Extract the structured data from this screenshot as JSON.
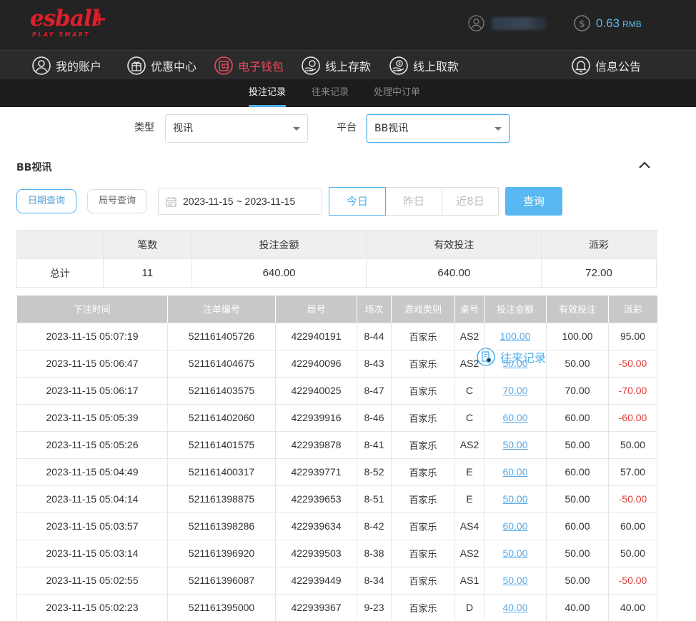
{
  "brand": {
    "logo_main": "esball",
    "logo_plus": "+",
    "logo_sub": "PLAY SMART",
    "color": "#e21e2a"
  },
  "account": {
    "balance": "0.63",
    "currency": "RMB"
  },
  "nav": [
    {
      "label": "我的账户",
      "icon": "user-icon"
    },
    {
      "label": "优惠中心",
      "icon": "gift-icon"
    },
    {
      "label": "电子钱包",
      "icon": "wallet-icon"
    },
    {
      "label": "线上存款",
      "icon": "deposit-icon"
    },
    {
      "label": "线上取款",
      "icon": "withdraw-icon"
    },
    {
      "label": "往来记录",
      "icon": "records-icon"
    },
    {
      "label": "信息公告",
      "icon": "bell-icon"
    }
  ],
  "subnav": [
    {
      "label": "投注记录",
      "active": true
    },
    {
      "label": "往来记录",
      "active": false
    },
    {
      "label": "处理中订单",
      "active": false
    }
  ],
  "filters": {
    "type_label": "类型",
    "type_value": "视讯",
    "platform_label": "平台",
    "platform_value": "BB视讯"
  },
  "section_title": "BB视讯",
  "query": {
    "date_query": "日期查询",
    "round_query": "局号查询",
    "date_range": "2023-11-15 ~ 2023-11-15",
    "today": "今日",
    "yesterday": "昨日",
    "last8": "近8日",
    "submit": "查询"
  },
  "summary": {
    "headers": [
      "",
      "笔数",
      "投注金额",
      "有效投注",
      "派彩"
    ],
    "row": [
      "总计",
      "11",
      "640.00",
      "640.00",
      "72.00"
    ]
  },
  "table": {
    "headers": [
      "下注时间",
      "注单编号",
      "局号",
      "场次",
      "游戏类别",
      "桌号",
      "投注金额",
      "有效投注",
      "派彩"
    ],
    "rows": [
      [
        "2023-11-15 05:07:19",
        "521161405726",
        "422940191",
        "8-44",
        "百家乐",
        "AS2",
        "100.00",
        "100.00",
        "95.00"
      ],
      [
        "2023-11-15 05:06:47",
        "521161404675",
        "422940096",
        "8-43",
        "百家乐",
        "AS2",
        "50.00",
        "50.00",
        "-50.00"
      ],
      [
        "2023-11-15 05:06:17",
        "521161403575",
        "422940025",
        "8-47",
        "百家乐",
        "C",
        "70.00",
        "70.00",
        "-70.00"
      ],
      [
        "2023-11-15 05:05:39",
        "521161402060",
        "422939916",
        "8-46",
        "百家乐",
        "C",
        "60.00",
        "60.00",
        "-60.00"
      ],
      [
        "2023-11-15 05:05:26",
        "521161401575",
        "422939878",
        "8-41",
        "百家乐",
        "AS2",
        "50.00",
        "50.00",
        "50.00"
      ],
      [
        "2023-11-15 05:04:49",
        "521161400317",
        "422939771",
        "8-52",
        "百家乐",
        "E",
        "60.00",
        "60.00",
        "57.00"
      ],
      [
        "2023-11-15 05:04:14",
        "521161398875",
        "422939653",
        "8-51",
        "百家乐",
        "E",
        "50.00",
        "50.00",
        "-50.00"
      ],
      [
        "2023-11-15 05:03:57",
        "521161398286",
        "422939634",
        "8-42",
        "百家乐",
        "AS4",
        "60.00",
        "60.00",
        "60.00"
      ],
      [
        "2023-11-15 05:03:14",
        "521161396920",
        "422939503",
        "8-38",
        "百家乐",
        "AS2",
        "50.00",
        "50.00",
        "50.00"
      ],
      [
        "2023-11-15 05:02:55",
        "521161396087",
        "422939449",
        "8-34",
        "百家乐",
        "AS1",
        "50.00",
        "50.00",
        "-50.00"
      ],
      [
        "2023-11-15 05:02:23",
        "521161395000",
        "422939367",
        "9-23",
        "百家乐",
        "D",
        "40.00",
        "40.00",
        "40.00"
      ]
    ]
  },
  "colors": {
    "accent": "#4fb0ee",
    "negative": "#e03c3c",
    "wallet": "#ee4a5a"
  }
}
